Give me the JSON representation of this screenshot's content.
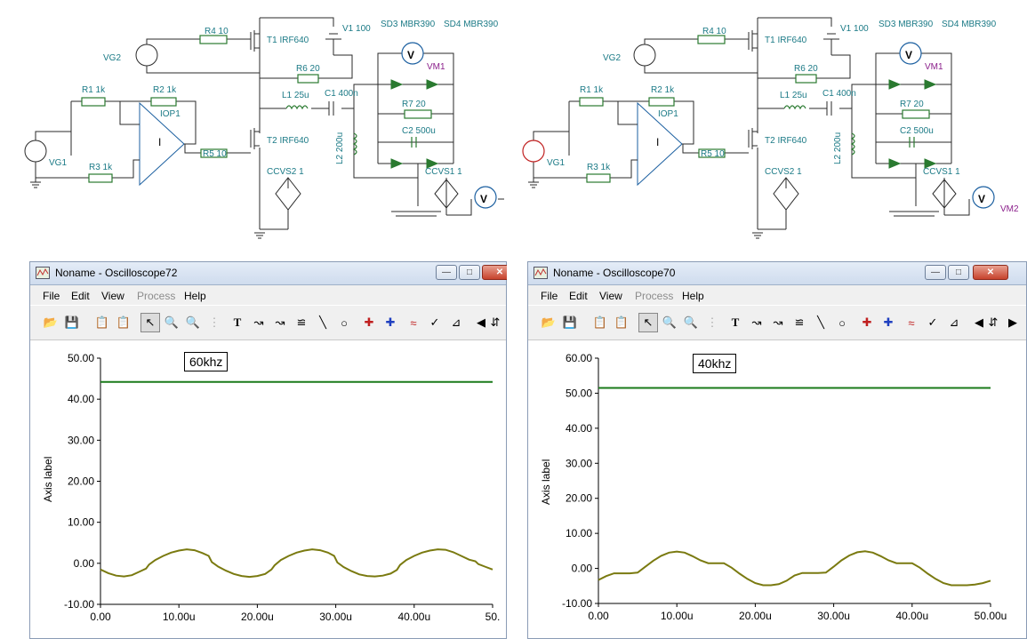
{
  "schematic": {
    "labels": {
      "r4": "R4 10",
      "t1": "T1 IRF640",
      "v1": "V1 100",
      "sd3": "SD3 MBR390",
      "sd4": "SD4 MBR390",
      "vg2": "VG2",
      "r6": "R6 20",
      "vm1": "VM1",
      "r1": "R1 1k",
      "r2": "R2 1k",
      "iop1": "IOP1",
      "l1": "L1 25u",
      "c1": "C1 400n",
      "r7": "R7 20",
      "c2": "C2 500u",
      "l2": "L2 200u",
      "vg1": "VG1",
      "r3": "R3 1k",
      "r5": "R5 10",
      "t2": "T2 IRF640",
      "ccvs2": "CCVS2 1",
      "ccvs1": "CCVS1 1",
      "vm2": "VM2",
      "volt_symbol": "V",
      "opamp_symbol": "I"
    }
  },
  "windows": [
    {
      "title": "Noname - Oscilloscope72",
      "menu": [
        {
          "label": "File",
          "enabled": true
        },
        {
          "label": "Edit",
          "enabled": true
        },
        {
          "label": "View",
          "enabled": true
        },
        {
          "label": "Process",
          "enabled": false
        },
        {
          "label": "Help",
          "enabled": true
        }
      ],
      "note": "60khz",
      "axis_label": "Axis label",
      "y_ticks": [
        "50.00",
        "40.00",
        "30.00",
        "20.00",
        "10.00",
        "0.00",
        "-10.00"
      ],
      "x_ticks": [
        "0.00",
        "10.00u",
        "20.00u",
        "30.00u",
        "40.00u",
        "50."
      ]
    },
    {
      "title": "Noname - Oscilloscope70",
      "menu": [
        {
          "label": "File",
          "enabled": true
        },
        {
          "label": "Edit",
          "enabled": true
        },
        {
          "label": "View",
          "enabled": true
        },
        {
          "label": "Process",
          "enabled": false
        },
        {
          "label": "Help",
          "enabled": true
        }
      ],
      "note": "40khz",
      "axis_label": "Axis label",
      "y_ticks": [
        "60.00",
        "50.00",
        "40.00",
        "30.00",
        "20.00",
        "10.00",
        "0.00",
        "-10.00"
      ],
      "x_ticks": [
        "0.00",
        "10.00u",
        "20.00u",
        "30.00u",
        "40.00u",
        "50.00u"
      ]
    }
  ],
  "chart_data": [
    {
      "type": "line",
      "title": "",
      "xlabel": "",
      "ylabel": "Axis label",
      "xlim": [
        0,
        50
      ],
      "ylim": [
        -10,
        50
      ],
      "series": [
        {
          "color": "#1a7a1a",
          "x": [
            0,
            50
          ],
          "y": [
            44.2,
            44.2
          ]
        },
        {
          "color": "#7a7a10",
          "x": [
            0,
            1,
            2,
            3,
            4,
            5,
            5.8,
            6.2,
            7,
            8,
            9,
            10,
            11,
            12,
            13,
            13.8,
            14.2,
            15,
            16,
            17,
            18,
            19,
            20,
            21,
            21.8,
            22.2,
            23,
            24,
            25,
            26,
            27,
            28,
            29,
            29.8,
            30.2,
            31,
            32,
            33,
            34,
            35,
            36,
            37,
            37.8,
            38.2,
            39,
            40,
            41,
            42,
            43,
            44,
            45,
            46,
            47,
            47.8,
            48.2,
            49,
            50
          ],
          "y": [
            -1.5,
            -2.4,
            -3.0,
            -3.2,
            -2.9,
            -2.0,
            -1.3,
            -0.3,
            0.8,
            1.8,
            2.6,
            3.1,
            3.4,
            3.2,
            2.5,
            1.8,
            0.3,
            -0.8,
            -1.8,
            -2.6,
            -3.1,
            -3.3,
            -3.1,
            -2.6,
            -1.5,
            -0.5,
            0.8,
            1.8,
            2.6,
            3.1,
            3.4,
            3.2,
            2.6,
            1.8,
            0.2,
            -0.9,
            -1.9,
            -2.7,
            -3.1,
            -3.2,
            -3.0,
            -2.5,
            -1.6,
            -0.4,
            0.8,
            1.8,
            2.6,
            3.1,
            3.4,
            3.3,
            2.7,
            1.8,
            0.9,
            0.5,
            -0.2,
            -0.8,
            -1.5
          ]
        }
      ]
    },
    {
      "type": "line",
      "title": "",
      "xlabel": "",
      "ylabel": "Axis label",
      "xlim": [
        0,
        50
      ],
      "ylim": [
        -10,
        60
      ],
      "series": [
        {
          "color": "#1a7a1a",
          "x": [
            0,
            50
          ],
          "y": [
            51.5,
            51.5
          ]
        },
        {
          "color": "#7a7a10",
          "x": [
            0,
            1,
            2,
            3,
            4,
            5,
            6,
            7,
            8,
            9,
            10,
            11,
            12,
            13,
            14,
            15,
            16,
            17,
            18,
            19,
            20,
            21,
            22,
            23,
            24,
            25,
            26,
            27,
            28,
            29,
            30,
            31,
            32,
            33,
            34,
            35,
            36,
            37,
            38,
            39,
            40,
            41,
            42,
            43,
            44,
            45,
            46,
            47,
            48,
            49,
            50
          ],
          "y": [
            -3.3,
            -2.2,
            -1.4,
            -1.4,
            -1.4,
            -1.2,
            0.5,
            2.2,
            3.6,
            4.5,
            4.8,
            4.5,
            3.5,
            2.3,
            1.5,
            1.5,
            1.5,
            0.2,
            -1.5,
            -3.0,
            -4.2,
            -4.8,
            -4.8,
            -4.5,
            -3.5,
            -2.0,
            -1.3,
            -1.3,
            -1.3,
            -1.2,
            0.5,
            2.3,
            3.7,
            4.6,
            4.9,
            4.5,
            3.5,
            2.3,
            1.5,
            1.5,
            1.5,
            0.2,
            -1.5,
            -3.0,
            -4.2,
            -4.8,
            -4.8,
            -4.8,
            -4.6,
            -4.2,
            -3.5
          ]
        }
      ]
    }
  ]
}
